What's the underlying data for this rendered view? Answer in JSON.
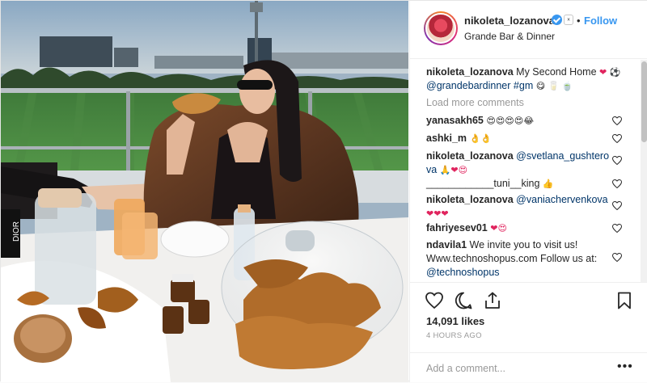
{
  "post": {
    "image_alt": "Woman in fur coat eating a croissant on a terrace overlooking a football pitch",
    "tag_text": "DIOR"
  },
  "header": {
    "username": "nikoleta_lozanova",
    "verified_icon": "verified-badge-icon",
    "dropdown_icon": "chevron-down-icon",
    "separator": "•",
    "follow_label": "Follow",
    "location": "Grande Bar & Dinner"
  },
  "caption": {
    "username": "nikoleta_lozanova",
    "text": "My Second Home",
    "emoji": "❤ ⚽",
    "mention": "@grandebardinner",
    "hashtag": "#gm",
    "trailing_emoji": "😋 🥛 🍵"
  },
  "load_more_label": "Load more comments",
  "comments": [
    {
      "username": "yanasakh65",
      "text": "",
      "emoji": "😍😍😍😍😂"
    },
    {
      "username": "ashki_m",
      "text": "",
      "emoji": "👌👌"
    },
    {
      "username": "nikoleta_lozanova",
      "mention": "@svetlana_gushtero",
      "mention2": "va",
      "emoji": "🙏❤😍"
    },
    {
      "username": "",
      "text": "____________tuni__king",
      "emoji": "👍"
    },
    {
      "username": "nikoleta_lozanova",
      "mention": "@vaniachervenkova",
      "emoji": "❤❤❤"
    },
    {
      "username": "fahriyesev01",
      "text": "",
      "emoji": "❤😍"
    },
    {
      "username": "ndavila1",
      "text": "We invite you to visit us!",
      "text2": "Www.technoshopus.com Follow us at:",
      "mention": "@technoshopus"
    }
  ],
  "actions": {
    "like_icon": "heart-icon",
    "comment_icon": "comment-icon",
    "share_icon": "share-icon",
    "save_icon": "bookmark-icon"
  },
  "likes_label": "14,091 likes",
  "time_label": "4 HOURS AGO",
  "add_comment": {
    "placeholder": "Add a comment...",
    "more_label": "•••"
  },
  "colors": {
    "link_blue": "#3897f0",
    "mention_navy": "#003569",
    "muted_gray": "#999999",
    "heart_red": "#e0245e"
  }
}
